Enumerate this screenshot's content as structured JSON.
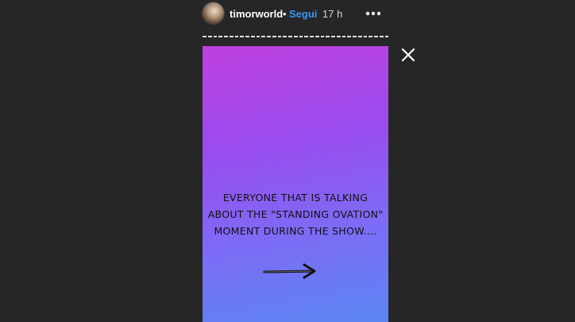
{
  "header": {
    "username": "timorworld",
    "separator": "•",
    "follow_label": "Segui",
    "time": "17 h",
    "avatar_icon": "profile-avatar",
    "more_icon": "more-dots-icon"
  },
  "progress": {
    "segments": 35
  },
  "close_icon": "close-icon",
  "story": {
    "lines": [
      "EVERYONE THAT IS TALKING",
      "ABOUT THE \"STANDING OVATION\"",
      "MOMENT DURING THE SHOW...."
    ],
    "arrow_icon": "arrow-right-icon",
    "gradient_start": "#bf40e0",
    "gradient_end": "#5a86f2"
  },
  "colors": {
    "background": "#262626",
    "follow": "#3897f0"
  }
}
